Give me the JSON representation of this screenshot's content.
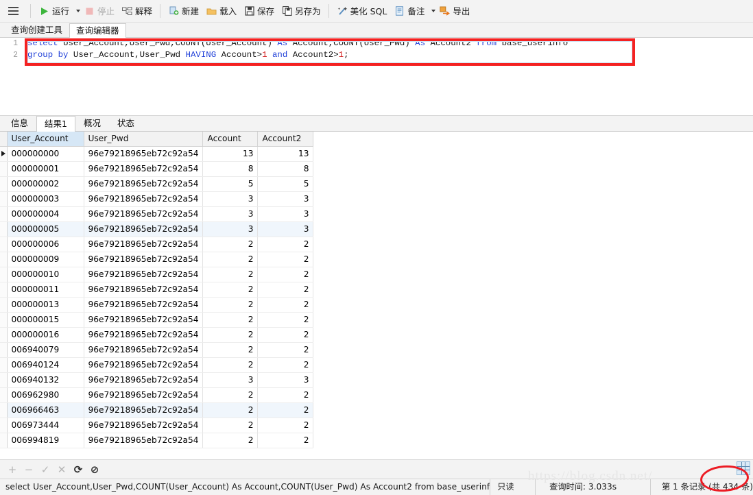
{
  "toolbar": {
    "menu_icon": "hamburger-icon",
    "buttons": [
      {
        "id": "run",
        "label": "运行",
        "icon": "play-icon",
        "disabled": false,
        "caret": true
      },
      {
        "id": "stop",
        "label": "停止",
        "icon": "stop-square-icon",
        "disabled": true,
        "caret": false
      },
      {
        "id": "explain",
        "label": "解释",
        "icon": "explain-icon",
        "disabled": false,
        "caret": false
      },
      {
        "id": "new",
        "label": "新建",
        "icon": "new-doc-icon",
        "disabled": false,
        "caret": false
      },
      {
        "id": "load",
        "label": "载入",
        "icon": "folder-icon",
        "disabled": false,
        "caret": false
      },
      {
        "id": "save",
        "label": "保存",
        "icon": "floppy-icon",
        "disabled": false,
        "caret": false
      },
      {
        "id": "save_as",
        "label": "另存为",
        "icon": "save-as-icon",
        "disabled": false,
        "caret": false
      },
      {
        "id": "beautify",
        "label": "美化 SQL",
        "icon": "magic-wand-icon",
        "disabled": false,
        "caret": false
      },
      {
        "id": "note",
        "label": "备注",
        "icon": "note-icon",
        "disabled": false,
        "caret": true
      },
      {
        "id": "export",
        "label": "导出",
        "icon": "export-icon",
        "disabled": false,
        "caret": false
      }
    ]
  },
  "tabs": {
    "items": [
      {
        "id": "query_builder",
        "label": "查询创建工具",
        "active": false
      },
      {
        "id": "query_editor",
        "label": "查询编辑器",
        "active": true
      }
    ]
  },
  "editor": {
    "line_numbers": [
      "1",
      "2"
    ],
    "lines": [
      [
        {
          "t": "select ",
          "k": "kw"
        },
        {
          "t": "User_Account,User_Pwd,COUNT(User_Account) ",
          "k": ""
        },
        {
          "t": "As ",
          "k": "kw"
        },
        {
          "t": "Account,COUNT(User_Pwd) ",
          "k": ""
        },
        {
          "t": "As ",
          "k": "kw"
        },
        {
          "t": "Account2 ",
          "k": ""
        },
        {
          "t": "from ",
          "k": "kw"
        },
        {
          "t": "base_userinfo",
          "k": ""
        }
      ],
      [
        {
          "t": "group by ",
          "k": "kw"
        },
        {
          "t": "User_Account,User_Pwd ",
          "k": ""
        },
        {
          "t": "HAVING ",
          "k": "kw"
        },
        {
          "t": "Account>",
          "k": ""
        },
        {
          "t": "1",
          "k": "num"
        },
        {
          "t": " and ",
          "k": "kw"
        },
        {
          "t": "Account2>",
          "k": ""
        },
        {
          "t": "1",
          "k": "num"
        },
        {
          "t": ";",
          "k": ""
        }
      ]
    ],
    "highlight_color": "#f42222"
  },
  "result_tabs": {
    "items": [
      {
        "id": "info",
        "label": "信息",
        "active": false
      },
      {
        "id": "result1",
        "label": "结果1",
        "active": true
      },
      {
        "id": "profile",
        "label": "概况",
        "active": false
      },
      {
        "id": "status",
        "label": "状态",
        "active": false
      }
    ]
  },
  "grid": {
    "columns": [
      "User_Account",
      "User_Pwd",
      "Account",
      "Account2"
    ],
    "selected_column": "User_Account",
    "current_row_index": 0,
    "rows": [
      {
        "User_Account": "000000000",
        "User_Pwd": "96e79218965eb72c92a54",
        "Account": "13",
        "Account2": "13"
      },
      {
        "User_Account": "000000001",
        "User_Pwd": "96e79218965eb72c92a54",
        "Account": "8",
        "Account2": "8"
      },
      {
        "User_Account": "000000002",
        "User_Pwd": "96e79218965eb72c92a54",
        "Account": "5",
        "Account2": "5"
      },
      {
        "User_Account": "000000003",
        "User_Pwd": "96e79218965eb72c92a54",
        "Account": "3",
        "Account2": "3"
      },
      {
        "User_Account": "000000004",
        "User_Pwd": "96e79218965eb72c92a54",
        "Account": "3",
        "Account2": "3"
      },
      {
        "User_Account": "000000005",
        "User_Pwd": "96e79218965eb72c92a54",
        "Account": "3",
        "Account2": "3"
      },
      {
        "User_Account": "000000006",
        "User_Pwd": "96e79218965eb72c92a54",
        "Account": "2",
        "Account2": "2"
      },
      {
        "User_Account": "000000009",
        "User_Pwd": "96e79218965eb72c92a54",
        "Account": "2",
        "Account2": "2"
      },
      {
        "User_Account": "000000010",
        "User_Pwd": "96e79218965eb72c92a54",
        "Account": "2",
        "Account2": "2"
      },
      {
        "User_Account": "000000011",
        "User_Pwd": "96e79218965eb72c92a54",
        "Account": "2",
        "Account2": "2"
      },
      {
        "User_Account": "000000013",
        "User_Pwd": "96e79218965eb72c92a54",
        "Account": "2",
        "Account2": "2"
      },
      {
        "User_Account": "000000015",
        "User_Pwd": "96e79218965eb72c92a54",
        "Account": "2",
        "Account2": "2"
      },
      {
        "User_Account": "000000016",
        "User_Pwd": "96e79218965eb72c92a54",
        "Account": "2",
        "Account2": "2"
      },
      {
        "User_Account": "006940079",
        "User_Pwd": "96e79218965eb72c92a54",
        "Account": "2",
        "Account2": "2"
      },
      {
        "User_Account": "006940124",
        "User_Pwd": "96e79218965eb72c92a54",
        "Account": "2",
        "Account2": "2"
      },
      {
        "User_Account": "006940132",
        "User_Pwd": "96e79218965eb72c92a54",
        "Account": "3",
        "Account2": "3"
      },
      {
        "User_Account": "006962980",
        "User_Pwd": "96e79218965eb72c92a54",
        "Account": "2",
        "Account2": "2"
      },
      {
        "User_Account": "006966463",
        "User_Pwd": "96e79218965eb72c92a54",
        "Account": "2",
        "Account2": "2"
      },
      {
        "User_Account": "006973444",
        "User_Pwd": "96e79218965eb72c92a54",
        "Account": "2",
        "Account2": "2"
      },
      {
        "User_Account": "006994819",
        "User_Pwd": "96e79218965eb72c92a54",
        "Account": "2",
        "Account2": "2"
      }
    ],
    "alt_row_indexes": [
      5,
      17
    ]
  },
  "record_nav": {
    "buttons": [
      {
        "id": "add",
        "glyph": "+",
        "icon": "plus-icon",
        "enabled": false
      },
      {
        "id": "delete",
        "glyph": "−",
        "icon": "minus-icon",
        "enabled": false
      },
      {
        "id": "confirm",
        "glyph": "✓",
        "icon": "check-icon",
        "enabled": false
      },
      {
        "id": "cancel",
        "glyph": "✕",
        "icon": "cross-icon",
        "enabled": false
      },
      {
        "id": "refresh",
        "glyph": "⟳",
        "icon": "refresh-icon",
        "enabled": true
      },
      {
        "id": "stop",
        "glyph": "⊘",
        "icon": "no-entry-icon",
        "enabled": true
      }
    ]
  },
  "status_bar": {
    "sql_text": "select User_Account,User_Pwd,COUNT(User_Account) As Account,COUNT(User_Pwd) As Account2 from base_userinfo gro",
    "read_only": "只读",
    "query_time": "查询时间: 3.033s",
    "record_info": "第 1 条记录 (共 434 条)",
    "grid_view_icon": "grid-view-icon",
    "highlight_color": "#ec1c24"
  },
  "watermark": {
    "text": "https://blog.csdn.net/"
  }
}
